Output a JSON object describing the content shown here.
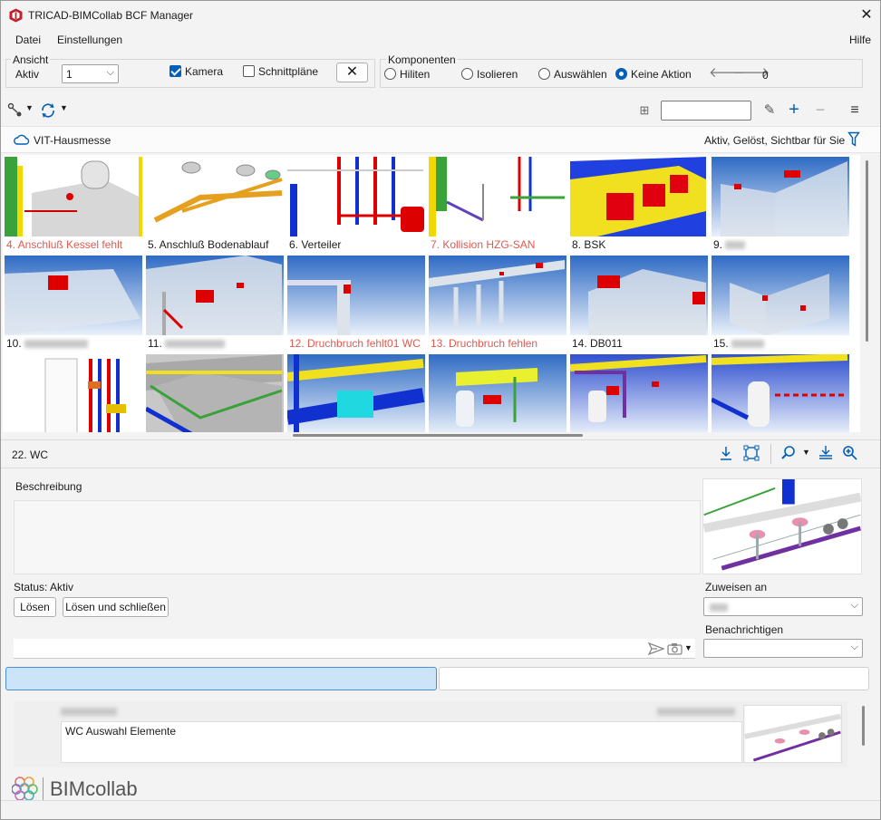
{
  "window": {
    "title": "TRICAD-BIMCollab BCF Manager",
    "close_glyph": "✕"
  },
  "menu": {
    "file": "Datei",
    "settings": "Einstellungen",
    "help": "Hilfe"
  },
  "view_group": {
    "title": "Ansicht",
    "active_label": "Aktiv",
    "active_value": "1",
    "camera_label": "Kamera",
    "camera_checked": true,
    "sections_label": "Schnittpläne",
    "sections_checked": false
  },
  "components_group": {
    "title": "Komponenten",
    "options": [
      "Hiliten",
      "Isolieren",
      "Auswählen",
      "Keine Aktion"
    ],
    "selected": "Keine Aktion",
    "counter": "0"
  },
  "project": {
    "name": "VIT-Hausmesse",
    "filter_text": "Aktiv, Gelöst, Sichtbar für Sie"
  },
  "gallery": {
    "row1": [
      {
        "label": "4. Anschluß Kessel fehlt",
        "red": true
      },
      {
        "label": "5. Anschluß Bodenablauf",
        "red": false
      },
      {
        "label": "6. Verteiler",
        "red": false
      },
      {
        "label": "7. Kollision HZG-SAN",
        "red": true
      },
      {
        "label": "8. BSK",
        "red": false
      },
      {
        "label": "9.",
        "red": false
      }
    ],
    "row2": [
      {
        "label": "10.",
        "red": false
      },
      {
        "label": "11.",
        "red": false
      },
      {
        "label": "12. Druchbruch fehlt01 WC",
        "red": true
      },
      {
        "label": "13. Druchbruch fehlen",
        "red": true
      },
      {
        "label": "14. DB011",
        "red": false
      },
      {
        "label": "15.",
        "red": false
      }
    ]
  },
  "issue": {
    "title": "22. WC",
    "description_label": "Beschreibung",
    "status": "Status: Aktiv",
    "resolve": "Lösen",
    "resolve_close": "Lösen und schließen",
    "assign_label": "Zuweisen an",
    "notify_label": "Benachrichtigen"
  },
  "comment": {
    "text": "WC Auswahl Elemente"
  },
  "brand": {
    "name": "BIMcollab"
  },
  "colors": {
    "accent": "#005fb8",
    "red_label": "#e05a4f",
    "tab_selected": "#cce4f7"
  }
}
